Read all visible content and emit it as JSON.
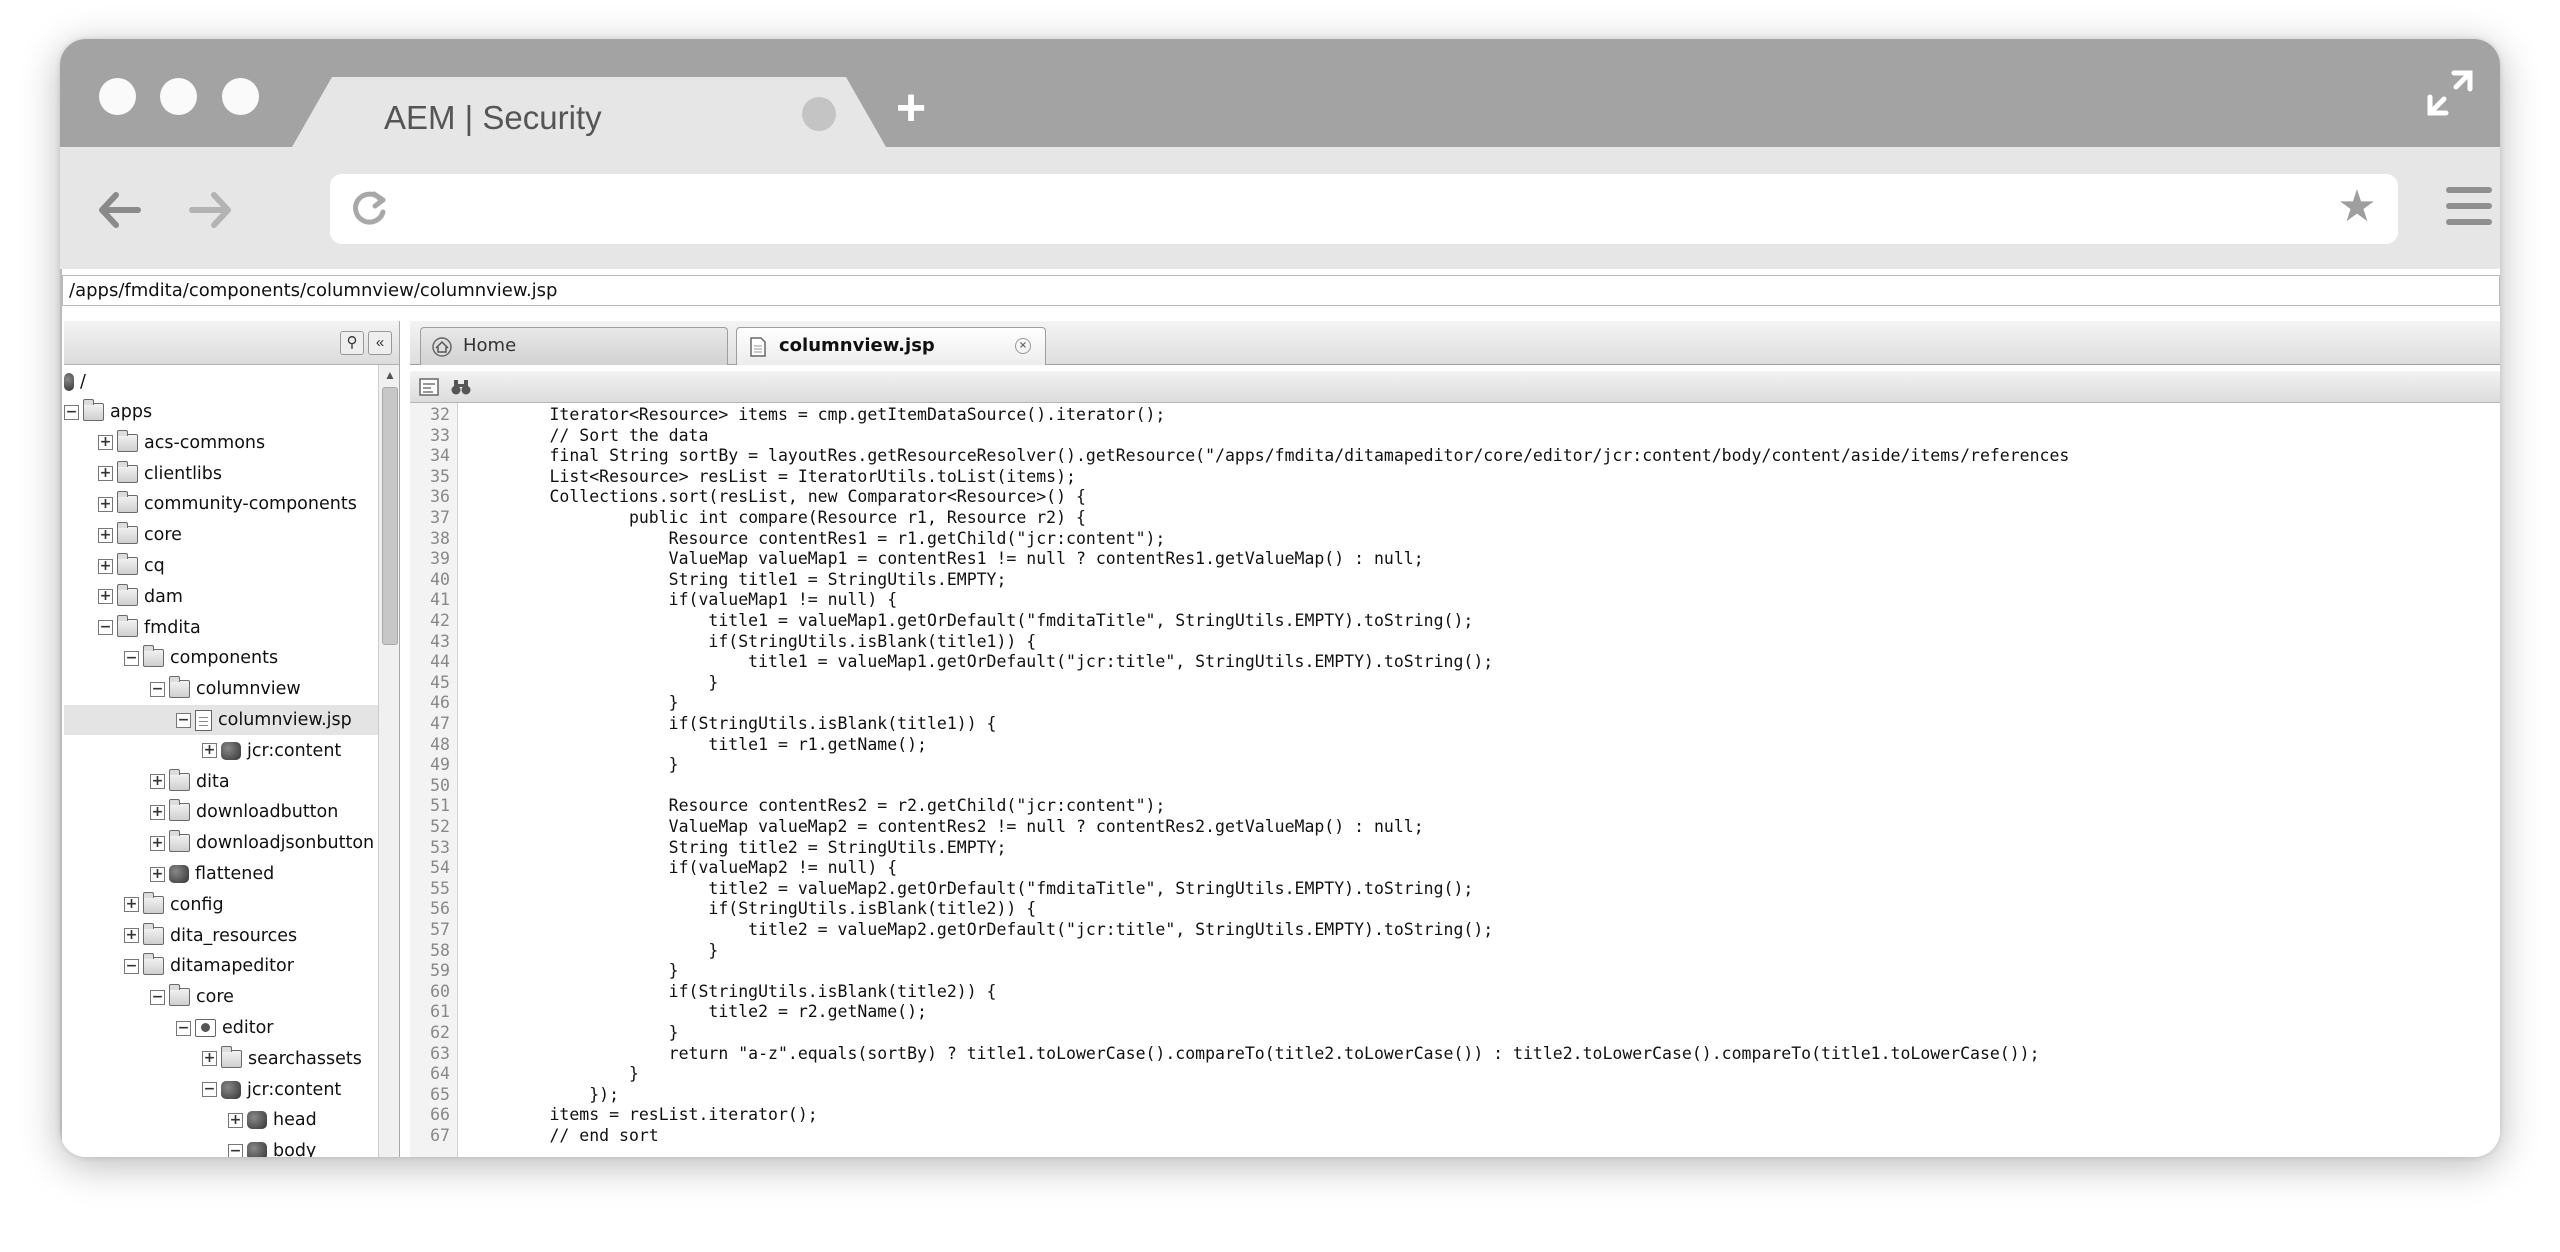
{
  "browser": {
    "tab_title": "AEM | Security",
    "url": ""
  },
  "aem": {
    "path": "/apps/fmdita/components/columnview/columnview.jsp",
    "tree_root": "/",
    "tree": [
      {
        "label": "apps",
        "level": 0,
        "toggle": "−",
        "icon": "folder"
      },
      {
        "label": "acs-commons",
        "level": 1,
        "toggle": "+",
        "icon": "folder"
      },
      {
        "label": "clientlibs",
        "level": 1,
        "toggle": "+",
        "icon": "folder"
      },
      {
        "label": "community-components",
        "level": 1,
        "toggle": "+",
        "icon": "folder"
      },
      {
        "label": "core",
        "level": 1,
        "toggle": "+",
        "icon": "folder"
      },
      {
        "label": "cq",
        "level": 1,
        "toggle": "+",
        "icon": "folder"
      },
      {
        "label": "dam",
        "level": 1,
        "toggle": "+",
        "icon": "folder"
      },
      {
        "label": "fmdita",
        "level": 1,
        "toggle": "−",
        "icon": "folder"
      },
      {
        "label": "components",
        "level": 2,
        "toggle": "−",
        "icon": "folder"
      },
      {
        "label": "columnview",
        "level": 3,
        "toggle": "−",
        "icon": "folder"
      },
      {
        "label": "columnview.jsp",
        "level": 4,
        "toggle": "−",
        "icon": "file",
        "selected": true
      },
      {
        "label": "jcr:content",
        "level": 5,
        "toggle": "+",
        "icon": "node"
      },
      {
        "label": "dita",
        "level": 3,
        "toggle": "+",
        "icon": "folder"
      },
      {
        "label": "downloadbutton",
        "level": 3,
        "toggle": "+",
        "icon": "folder"
      },
      {
        "label": "downloadjsonbutton",
        "level": 3,
        "toggle": "+",
        "icon": "folder"
      },
      {
        "label": "flattened",
        "level": 3,
        "toggle": "+",
        "icon": "node"
      },
      {
        "label": "config",
        "level": 2,
        "toggle": "+",
        "icon": "folder"
      },
      {
        "label": "dita_resources",
        "level": 2,
        "toggle": "+",
        "icon": "folder"
      },
      {
        "label": "ditamapeditor",
        "level": 2,
        "toggle": "−",
        "icon": "folder"
      },
      {
        "label": "core",
        "level": 3,
        "toggle": "−",
        "icon": "folder"
      },
      {
        "label": "editor",
        "level": 4,
        "toggle": "−",
        "icon": "comp"
      },
      {
        "label": "searchassets",
        "level": 5,
        "toggle": "+",
        "icon": "folder"
      },
      {
        "label": "jcr:content",
        "level": 5,
        "toggle": "−",
        "icon": "node"
      },
      {
        "label": "head",
        "level": 6,
        "toggle": "+",
        "icon": "node"
      },
      {
        "label": "body",
        "level": 6,
        "toggle": "−",
        "icon": "node"
      }
    ],
    "editor_tabs": [
      {
        "label": "Home",
        "active": false
      },
      {
        "label": "columnview.jsp",
        "active": true
      }
    ],
    "code": [
      {
        "n": "32",
        "t": "        Iterator<Resource> items = cmp.getItemDataSource().iterator();"
      },
      {
        "n": "33",
        "t": "        // Sort the data"
      },
      {
        "n": "34",
        "t": "        final String sortBy = layoutRes.getResourceResolver().getResource(\"/apps/fmdita/ditamapeditor/core/editor/jcr:content/body/content/aside/items/references"
      },
      {
        "n": "35",
        "t": "        List<Resource> resList = IteratorUtils.toList(items);"
      },
      {
        "n": "36",
        "t": "        Collections.sort(resList, new Comparator<Resource>() {"
      },
      {
        "n": "37",
        "t": "                public int compare(Resource r1, Resource r2) {"
      },
      {
        "n": "38",
        "t": "                    Resource contentRes1 = r1.getChild(\"jcr:content\");"
      },
      {
        "n": "39",
        "t": "                    ValueMap valueMap1 = contentRes1 != null ? contentRes1.getValueMap() : null;"
      },
      {
        "n": "40",
        "t": "                    String title1 = StringUtils.EMPTY;"
      },
      {
        "n": "41",
        "t": "                    if(valueMap1 != null) {"
      },
      {
        "n": "42",
        "t": "                        title1 = valueMap1.getOrDefault(\"fmditaTitle\", StringUtils.EMPTY).toString();"
      },
      {
        "n": "43",
        "t": "                        if(StringUtils.isBlank(title1)) {"
      },
      {
        "n": "44",
        "t": "                            title1 = valueMap1.getOrDefault(\"jcr:title\", StringUtils.EMPTY).toString();"
      },
      {
        "n": "45",
        "t": "                        }"
      },
      {
        "n": "46",
        "t": "                    }"
      },
      {
        "n": "47",
        "t": "                    if(StringUtils.isBlank(title1)) {"
      },
      {
        "n": "48",
        "t": "                        title1 = r1.getName();"
      },
      {
        "n": "49",
        "t": "                    }"
      },
      {
        "n": "50",
        "t": ""
      },
      {
        "n": "51",
        "t": "                    Resource contentRes2 = r2.getChild(\"jcr:content\");"
      },
      {
        "n": "52",
        "t": "                    ValueMap valueMap2 = contentRes2 != null ? contentRes2.getValueMap() : null;"
      },
      {
        "n": "53",
        "t": "                    String title2 = StringUtils.EMPTY;"
      },
      {
        "n": "54",
        "t": "                    if(valueMap2 != null) {"
      },
      {
        "n": "55",
        "t": "                        title2 = valueMap2.getOrDefault(\"fmditaTitle\", StringUtils.EMPTY).toString();"
      },
      {
        "n": "56",
        "t": "                        if(StringUtils.isBlank(title2)) {"
      },
      {
        "n": "57",
        "t": "                            title2 = valueMap2.getOrDefault(\"jcr:title\", StringUtils.EMPTY).toString();"
      },
      {
        "n": "58",
        "t": "                        }"
      },
      {
        "n": "59",
        "t": "                    }"
      },
      {
        "n": "60",
        "t": "                    if(StringUtils.isBlank(title2)) {"
      },
      {
        "n": "61",
        "t": "                        title2 = r2.getName();"
      },
      {
        "n": "62",
        "t": "                    }"
      },
      {
        "n": "63",
        "t": "                    return \"a-z\".equals(sortBy) ? title1.toLowerCase().compareTo(title2.toLowerCase()) : title2.toLowerCase().compareTo(title1.toLowerCase());"
      },
      {
        "n": "64",
        "t": "                }"
      },
      {
        "n": "65",
        "t": "            });"
      },
      {
        "n": "66",
        "t": "        items = resList.iterator();"
      },
      {
        "n": "67",
        "t": "        // end sort"
      }
    ]
  }
}
